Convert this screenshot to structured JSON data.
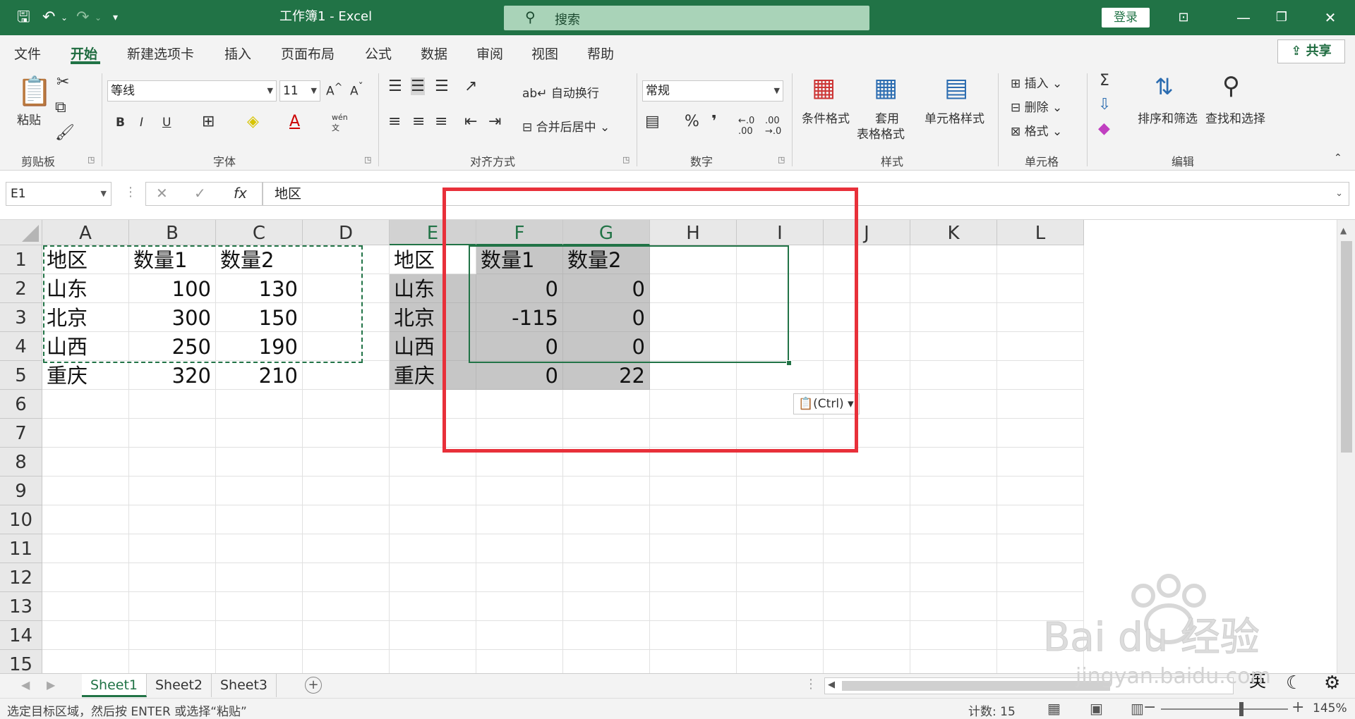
{
  "titlebar": {
    "doc_title": "工作簿1  -  Excel",
    "search_placeholder": "搜索",
    "login_label": "登录"
  },
  "ribbon_tabs": [
    "文件",
    "开始",
    "新建选项卡",
    "插入",
    "页面布局",
    "公式",
    "数据",
    "审阅",
    "视图",
    "帮助"
  ],
  "share_label": "共享",
  "ribbon": {
    "clipboard": {
      "paste": "粘贴",
      "group": "剪贴板"
    },
    "font": {
      "name": "等线",
      "size": "11",
      "group": "字体",
      "bold": "B",
      "italic": "I",
      "underline": "U"
    },
    "alignment": {
      "wrap": "自动换行",
      "merge": "合并后居中",
      "group": "对齐方式"
    },
    "number": {
      "format": "常规",
      "group": "数字"
    },
    "styles": {
      "conditional": "条件格式",
      "table1": "套用",
      "table2": "表格格式",
      "cell_styles": "单元格样式",
      "group": "样式"
    },
    "cells": {
      "insert": "插入",
      "delete": "删除",
      "format": "格式",
      "group": "单元格"
    },
    "editing": {
      "sort": "排序和筛选",
      "find": "查找和选择",
      "group": "编辑"
    }
  },
  "formula_bar": {
    "name_box": "E1",
    "formula": "地区"
  },
  "columns": [
    "A",
    "B",
    "C",
    "D",
    "E",
    "F",
    "G",
    "H",
    "I",
    "J",
    "K",
    "L"
  ],
  "selected_columns": [
    "E",
    "F",
    "G"
  ],
  "rows": [
    "1",
    "2",
    "3",
    "4",
    "5",
    "6",
    "7",
    "8",
    "9",
    "10",
    "11",
    "12",
    "13",
    "14",
    "15"
  ],
  "sheet": {
    "source": [
      [
        "地区",
        "数量1",
        "数量2"
      ],
      [
        "山东",
        "100",
        "130"
      ],
      [
        "北京",
        "300",
        "150"
      ],
      [
        "山西",
        "250",
        "190"
      ],
      [
        "重庆",
        "320",
        "210"
      ]
    ],
    "pasted": [
      [
        "地区",
        "数量1",
        "数量2"
      ],
      [
        "山东",
        "0",
        "0"
      ],
      [
        "北京",
        "-115",
        "0"
      ],
      [
        "山西",
        "0",
        "0"
      ],
      [
        "重庆",
        "0",
        "22"
      ]
    ]
  },
  "paste_options_label": "(Ctrl)",
  "sheet_tabs": [
    "Sheet1",
    "Sheet2",
    "Sheet3"
  ],
  "active_sheet": "Sheet1",
  "status": {
    "message": "选定目标区域，然后按 ENTER 或选择“粘贴”",
    "count": "计数: 15",
    "zoom": "145%"
  },
  "ime_label": "英",
  "watermark": {
    "brand": "Bai  du 经验",
    "url": "jingyan.baidu.com"
  },
  "colors": {
    "excel_green": "#217346",
    "highlight_red": "#e8303a",
    "selection_gray": "#c6c6c6"
  }
}
